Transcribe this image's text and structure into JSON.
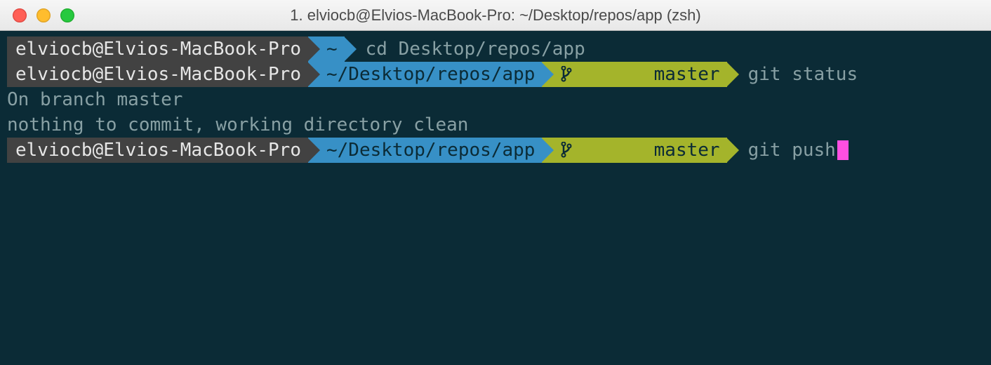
{
  "window": {
    "title": "1. elviocb@Elvios-MacBook-Pro: ~/Desktop/repos/app (zsh)"
  },
  "prompt": {
    "host": "elviocb@Elvios-MacBook-Pro",
    "home_path": "~",
    "repo_path": "~/Desktop/repos/app",
    "branch": "master"
  },
  "lines": {
    "cmd1": "cd Desktop/repos/app",
    "cmd2": "git status",
    "out1": "On branch master",
    "out2": "nothing to commit, working directory clean",
    "cmd3": "git push"
  },
  "colors": {
    "bg": "#0b2b36",
    "host_bg": "#424242",
    "path_bg": "#3790c6",
    "branch_bg": "#a4b42b",
    "cursor": "#ff4fe1"
  }
}
